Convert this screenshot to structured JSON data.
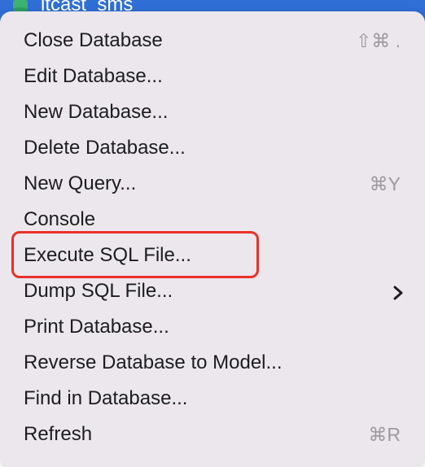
{
  "header": {
    "database_name": "itcast_sms",
    "database_icon": "database-icon"
  },
  "menu": {
    "items": [
      {
        "label": "Close Database",
        "shortcut": "⇧⌘ ."
      },
      {
        "label": "Edit Database..."
      },
      {
        "label": "New Database..."
      },
      {
        "label": "Delete Database..."
      },
      {
        "label": "New Query...",
        "shortcut": "⌘Y"
      },
      {
        "label": "Console"
      },
      {
        "label": "Execute SQL File...",
        "highlighted": true
      },
      {
        "label": "Dump SQL File...",
        "has_submenu": true
      },
      {
        "label": "Print Database..."
      },
      {
        "label": "Reverse Database to Model..."
      },
      {
        "label": "Find in Database..."
      },
      {
        "label": "Refresh",
        "shortcut": "⌘R"
      }
    ]
  },
  "colors": {
    "highlight_border": "#e8302a",
    "selection_blue": "#2f6fd6",
    "menu_background": "#ebe7ec"
  }
}
